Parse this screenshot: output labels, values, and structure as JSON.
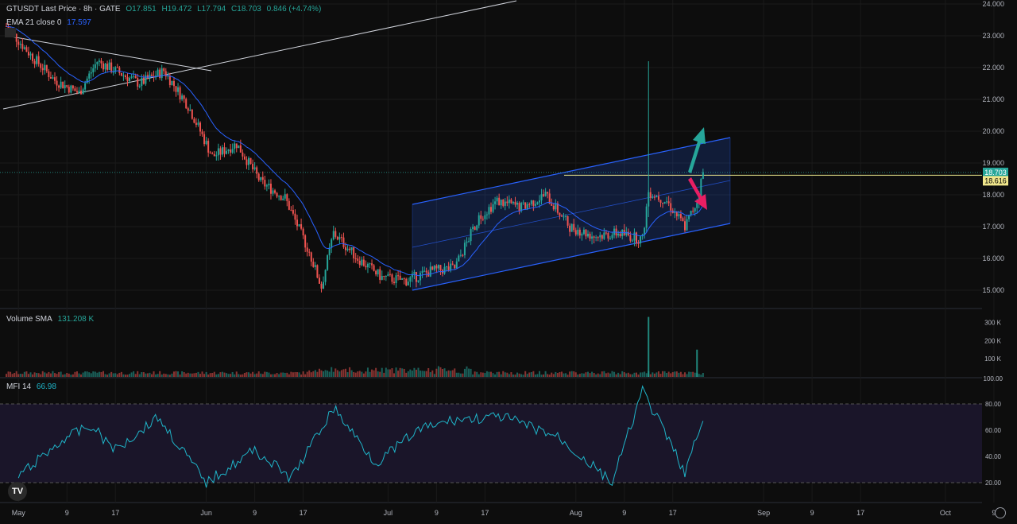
{
  "header": {
    "symbol": "GTUSDT Last Price · 8h · GATE",
    "open": "O17.851",
    "high": "H19.472",
    "low": "L17.794",
    "close": "C18.703",
    "change": "0.846 (+4.74%)",
    "ema_label": "EMA 21 close 0",
    "ema_value": "17.597"
  },
  "volume_panel": {
    "label": "Volume SMA",
    "value": "131.208 K"
  },
  "mfi_panel": {
    "label": "MFI 14",
    "value": "66.98"
  },
  "price_axis": {
    "ticks": [
      "24.000",
      "23.000",
      "22.000",
      "21.000",
      "20.000",
      "19.000",
      "18.000",
      "17.000",
      "16.000",
      "15.000"
    ],
    "last_price": "18.703",
    "ema_price": "18.616"
  },
  "volume_axis": {
    "ticks": [
      "300 K",
      "200 K",
      "100 K",
      "100.00"
    ]
  },
  "mfi_axis": {
    "ticks": [
      "80.00",
      "60.00",
      "40.00",
      "20.00"
    ]
  },
  "time_axis": [
    "May",
    "9",
    "17",
    "Jun",
    "9",
    "17",
    "Jul",
    "9",
    "17",
    "Aug",
    "9",
    "17",
    "Sep",
    "9",
    "17",
    "Oct",
    "9"
  ],
  "logo_text": "TV",
  "colors": {
    "up": "#26a69a",
    "down": "#ef5350",
    "ema": "#2962ff",
    "channel": "#2962ff",
    "mfi": "#1fb5c9",
    "arrow_up": "#26a69a",
    "arrow_down": "#e91e63"
  },
  "chart_data": {
    "type": "candlestick",
    "title": "GTUSDT Last Price · 8h · GATE",
    "ylim": [
      14.7,
      24.0
    ],
    "price_series": [
      {
        "date": "Apr 29",
        "price": 23.3
      },
      {
        "date": "May 3",
        "price": 22.4
      },
      {
        "date": "May 7",
        "price": 21.6
      },
      {
        "date": "May 11",
        "price": 21.2
      },
      {
        "date": "May 14",
        "price": 22.2
      },
      {
        "date": "May 18",
        "price": 21.8
      },
      {
        "date": "May 21",
        "price": 21.5
      },
      {
        "date": "May 25",
        "price": 21.9
      },
      {
        "date": "May 29",
        "price": 20.8
      },
      {
        "date": "Jun 2",
        "price": 19.2
      },
      {
        "date": "Jun 6",
        "price": 19.6
      },
      {
        "date": "Jun 10",
        "price": 18.4
      },
      {
        "date": "Jun 14",
        "price": 17.9
      },
      {
        "date": "Jun 18",
        "price": 16.2
      },
      {
        "date": "Jun 20",
        "price": 15.1
      },
      {
        "date": "Jun 22",
        "price": 16.8
      },
      {
        "date": "Jun 26",
        "price": 16.0
      },
      {
        "date": "Jun 30",
        "price": 15.4
      },
      {
        "date": "Jul 4",
        "price": 15.3
      },
      {
        "date": "Jul 8",
        "price": 15.6
      },
      {
        "date": "Jul 12",
        "price": 15.7
      },
      {
        "date": "Jul 16",
        "price": 17.3
      },
      {
        "date": "Jul 19",
        "price": 17.8
      },
      {
        "date": "Jul 23",
        "price": 17.6
      },
      {
        "date": "Jul 27",
        "price": 18.0
      },
      {
        "date": "Jul 31",
        "price": 17.0
      },
      {
        "date": "Aug 4",
        "price": 16.7
      },
      {
        "date": "Aug 8",
        "price": 16.8
      },
      {
        "date": "Aug 12",
        "price": 16.6
      },
      {
        "date": "Aug 13",
        "price": 18.1
      },
      {
        "date": "Aug 16",
        "price": 17.8
      },
      {
        "date": "Aug 19",
        "price": 17.0
      },
      {
        "date": "Aug 21",
        "price": 17.8
      },
      {
        "date": "Aug 22",
        "price": 18.7
      }
    ],
    "ema_21_last": 17.597,
    "volume_sma_last": "131.208 K",
    "mfi_14_last": 66.98,
    "mfi_series": [
      {
        "date": "May 1",
        "value": 25
      },
      {
        "date": "May 9",
        "value": 55
      },
      {
        "date": "May 13",
        "value": 63
      },
      {
        "date": "May 17",
        "value": 45
      },
      {
        "date": "May 24",
        "value": 70
      },
      {
        "date": "Jun 1",
        "value": 20
      },
      {
        "date": "Jun 9",
        "value": 45
      },
      {
        "date": "Jun 15",
        "value": 23
      },
      {
        "date": "Jun 22",
        "value": 77
      },
      {
        "date": "Jun 29",
        "value": 35
      },
      {
        "date": "Jul 6",
        "value": 60
      },
      {
        "date": "Jul 12",
        "value": 68
      },
      {
        "date": "Jul 20",
        "value": 70
      },
      {
        "date": "Jul 29",
        "value": 55
      },
      {
        "date": "Aug 7",
        "value": 20
      },
      {
        "date": "Aug 12",
        "value": 90
      },
      {
        "date": "Aug 16",
        "value": 55
      },
      {
        "date": "Aug 19",
        "value": 28
      },
      {
        "date": "Aug 22",
        "value": 67
      }
    ],
    "volume_spikes": [
      {
        "date": "Aug 13",
        "value": 330000
      },
      {
        "date": "Aug 21",
        "value": 150000
      }
    ],
    "grid": true
  }
}
